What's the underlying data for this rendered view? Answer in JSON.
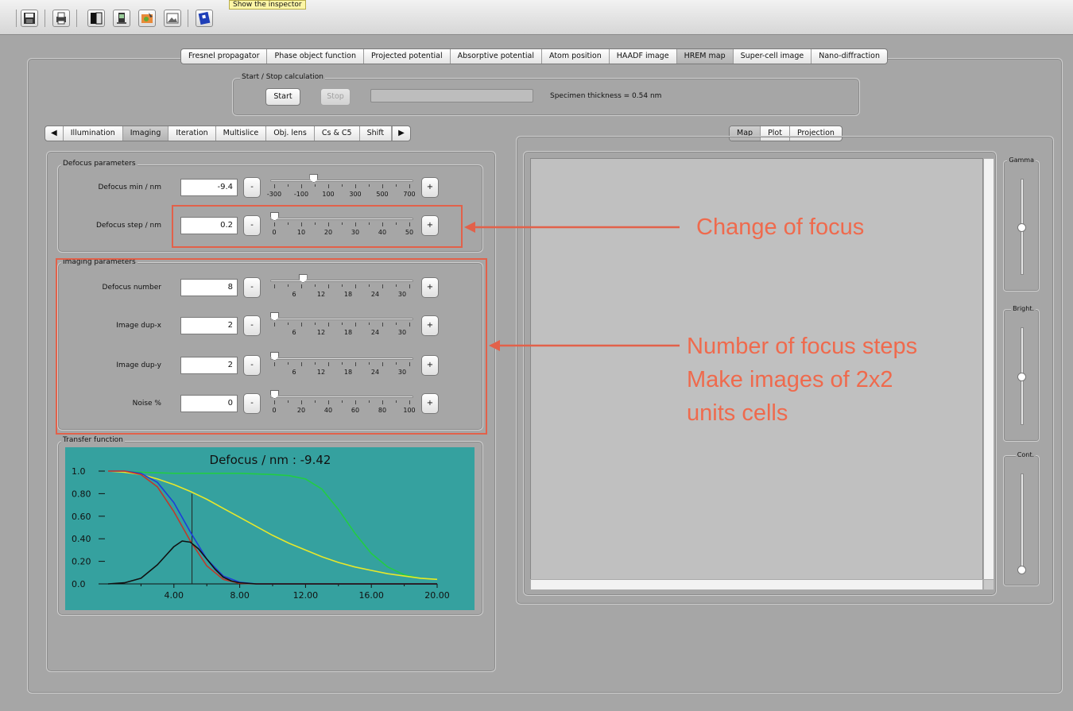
{
  "toolbar": {
    "tooltip": "Show the inspector",
    "icons": [
      "save-icon",
      "print-icon",
      "contrast-icon",
      "pda-icon",
      "edit-image-icon",
      "image-icon",
      "book-icon"
    ]
  },
  "main_tabs": [
    {
      "label": "Fresnel propagator"
    },
    {
      "label": "Phase object function"
    },
    {
      "label": "Projected potential"
    },
    {
      "label": "Absorptive potential"
    },
    {
      "label": "Atom position"
    },
    {
      "label": "HAADF image"
    },
    {
      "label": "HREM map",
      "active": true
    },
    {
      "label": "Super-cell image"
    },
    {
      "label": "Nano-diffraction"
    }
  ],
  "calc": {
    "group_title": "Start / Stop calculation",
    "start_label": "Start",
    "stop_label": "Stop",
    "progress": 0,
    "status": "Specimen thickness = 0.54 nm"
  },
  "left_tabs": [
    {
      "label": "Illumination"
    },
    {
      "label": "Imaging",
      "active": true
    },
    {
      "label": "Iteration"
    },
    {
      "label": "Multislice"
    },
    {
      "label": "Obj. lens"
    },
    {
      "label": "Cs & C5"
    },
    {
      "label": "Shift"
    }
  ],
  "defocus_group": {
    "title": "Defocus parameters",
    "rows": [
      {
        "label": "Defocus min / nm",
        "value": "-9.4",
        "minus": "-",
        "plus": "+",
        "tick_labels": [
          "-300",
          "-100",
          "100",
          "300",
          "500",
          "700"
        ],
        "fraction": 0.29
      },
      {
        "label": "Defocus step / nm",
        "value": "0.2",
        "minus": "-",
        "plus": "+",
        "tick_labels": [
          "0",
          "10",
          "20",
          "30",
          "40",
          "50"
        ],
        "fraction": 0.0
      }
    ]
  },
  "imaging_group": {
    "title": "Imaging parameters",
    "rows": [
      {
        "label": "Defocus number",
        "value": "8",
        "minus": "-",
        "plus": "+",
        "tick_labels": [
          "6",
          "12",
          "18",
          "24",
          "30"
        ],
        "fraction": 0.21
      },
      {
        "label": "Image dup-x",
        "value": "2",
        "minus": "-",
        "plus": "+",
        "tick_labels": [
          "6",
          "12",
          "18",
          "24",
          "30"
        ],
        "fraction": 0.0
      },
      {
        "label": "Image dup-y",
        "value": "2",
        "minus": "-",
        "plus": "+",
        "tick_labels": [
          "6",
          "12",
          "18",
          "24",
          "30"
        ],
        "fraction": 0.0
      },
      {
        "label": "Noise %",
        "value": "0",
        "minus": "-",
        "plus": "+",
        "tick_labels": [
          "0",
          "20",
          "40",
          "60",
          "80",
          "100"
        ],
        "fraction": 0.0
      }
    ]
  },
  "transfer": {
    "group_title": "Transfer function",
    "chart_data": {
      "type": "line",
      "title": "Defocus / nm : -9.42",
      "xlabel": "",
      "ylabel": "",
      "xlim": [
        0,
        20
      ],
      "ylim": [
        0,
        1
      ],
      "x_tick_labels": [
        "4.00",
        "8.00",
        "12.00",
        "16.00",
        "20.00"
      ],
      "y_tick_labels": [
        "1.0",
        "0.80",
        "0.60",
        "0.40",
        "0.20",
        "0.0"
      ],
      "marker_x": 5.1,
      "series": [
        {
          "color": "#22cc44",
          "x": [
            0,
            2,
            4,
            6,
            8,
            10,
            11,
            12,
            13,
            14,
            15,
            16,
            17,
            18,
            19,
            20
          ],
          "y": [
            1.0,
            0.99,
            0.98,
            0.98,
            0.98,
            0.97,
            0.96,
            0.93,
            0.84,
            0.66,
            0.45,
            0.27,
            0.15,
            0.08,
            0.05,
            0.04
          ]
        },
        {
          "color": "#e8e82a",
          "x": [
            0,
            1,
            2,
            3,
            4,
            5,
            6,
            7,
            8,
            9,
            10,
            11,
            12,
            13,
            14,
            15,
            16,
            17,
            18,
            19,
            20
          ],
          "y": [
            1.0,
            0.99,
            0.97,
            0.93,
            0.88,
            0.82,
            0.75,
            0.67,
            0.59,
            0.51,
            0.43,
            0.36,
            0.3,
            0.24,
            0.19,
            0.15,
            0.12,
            0.09,
            0.07,
            0.05,
            0.04
          ]
        },
        {
          "color": "#1d3fd9",
          "x": [
            0,
            1,
            2,
            3,
            4,
            5,
            6,
            7,
            8,
            9,
            10,
            11,
            12,
            20
          ],
          "y": [
            1.0,
            1.0,
            0.98,
            0.9,
            0.72,
            0.46,
            0.22,
            0.07,
            0.015,
            0.0,
            0.0,
            0.0,
            0.0,
            0.0
          ]
        },
        {
          "color": "#c0392b",
          "x": [
            0,
            1,
            2,
            3,
            4,
            5,
            6,
            7,
            8,
            9,
            10,
            20
          ],
          "y": [
            1.0,
            1.0,
            0.97,
            0.86,
            0.64,
            0.38,
            0.16,
            0.04,
            0.005,
            0.0,
            0.0,
            0.0
          ]
        },
        {
          "color": "#111111",
          "x": [
            0,
            1,
            2,
            3,
            3.5,
            4,
            4.5,
            5,
            5.5,
            6,
            6.5,
            7,
            7.5,
            8,
            9,
            10,
            20
          ],
          "y": [
            0.0,
            0.01,
            0.05,
            0.17,
            0.25,
            0.33,
            0.38,
            0.37,
            0.31,
            0.22,
            0.13,
            0.06,
            0.025,
            0.01,
            0.0,
            0.0,
            0.0
          ]
        }
      ]
    }
  },
  "right_tabs": [
    {
      "label": "Map",
      "active": true
    },
    {
      "label": "Plot"
    },
    {
      "label": "Projection"
    }
  ],
  "vsliders": [
    {
      "label": "Gamma",
      "fraction": 0.5
    },
    {
      "label": "Bright.",
      "fraction": 0.5
    },
    {
      "label": "Cont.",
      "fraction": 0.0
    }
  ],
  "annotations": {
    "focus": "Change of focus",
    "steps_line1": "Number of focus steps",
    "steps_line2": "Make images of 2x2",
    "steps_line3": "units cells"
  }
}
